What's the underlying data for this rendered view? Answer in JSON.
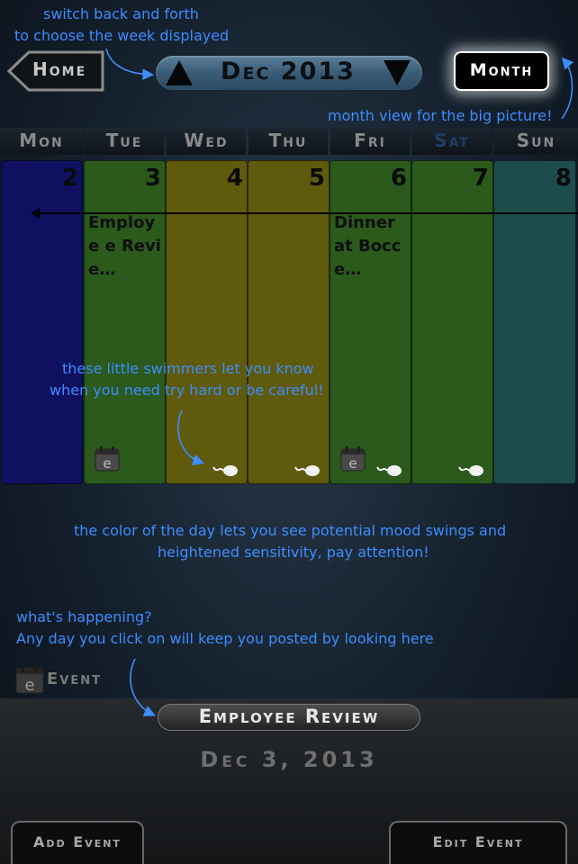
{
  "header": {
    "home_label": "Home",
    "week_label": "Dec 2013",
    "month_label": "Month"
  },
  "days": [
    {
      "name": "Mon",
      "date": "2",
      "color": "#0f1060",
      "event": "",
      "has_event_icon": false,
      "has_swimmer": false
    },
    {
      "name": "Tue",
      "date": "3",
      "color": "#2b5a1c",
      "event": "Employe e Revie…",
      "has_event_icon": true,
      "has_swimmer": false
    },
    {
      "name": "Wed",
      "date": "4",
      "color": "#5f5a0c",
      "event": "",
      "has_event_icon": false,
      "has_swimmer": true
    },
    {
      "name": "Thu",
      "date": "5",
      "color": "#5f5a0c",
      "event": "",
      "has_event_icon": false,
      "has_swimmer": true
    },
    {
      "name": "Fri",
      "date": "6",
      "color": "#2b5a1c",
      "event": "Dinner at Bocce…",
      "has_event_icon": true,
      "has_swimmer": true
    },
    {
      "name": "Sat",
      "date": "7",
      "color": "#2b5a1c",
      "event": "",
      "has_event_icon": false,
      "has_swimmer": true
    },
    {
      "name": "Sun",
      "date": "8",
      "color": "#1e4c4c",
      "event": "",
      "has_event_icon": false,
      "has_swimmer": false
    }
  ],
  "annotations": {
    "week_switch_line1": "switch back and forth",
    "week_switch_line2": "to choose the week displayed",
    "month_view": "month view for the big picture!",
    "swimmers_line1": "these little swimmers let you know",
    "swimmers_line2": "when you need try hard or be careful!",
    "color_line1": "the color of the day lets you see potential mood swings and",
    "color_line2": "heightened sensitivity, pay attention!",
    "happening_line1": "what's happening?",
    "happening_line2": "Any day you click on will keep you posted by looking here"
  },
  "event_section": {
    "label": "Event",
    "title": "Employee Review",
    "date": "Dec 3, 2013"
  },
  "footer": {
    "add_label": "Add Event",
    "edit_label": "Edit Event"
  },
  "colors": {
    "annotation": "#3d8dff",
    "mon": "#0f1060",
    "green": "#2b5a1c",
    "olive": "#5f5a0c",
    "teal": "#1e4c4c"
  },
  "icons": [
    "home-arrow-icon",
    "triangle-up-icon",
    "triangle-down-icon",
    "calendar-event-icon",
    "swimmer-icon"
  ]
}
